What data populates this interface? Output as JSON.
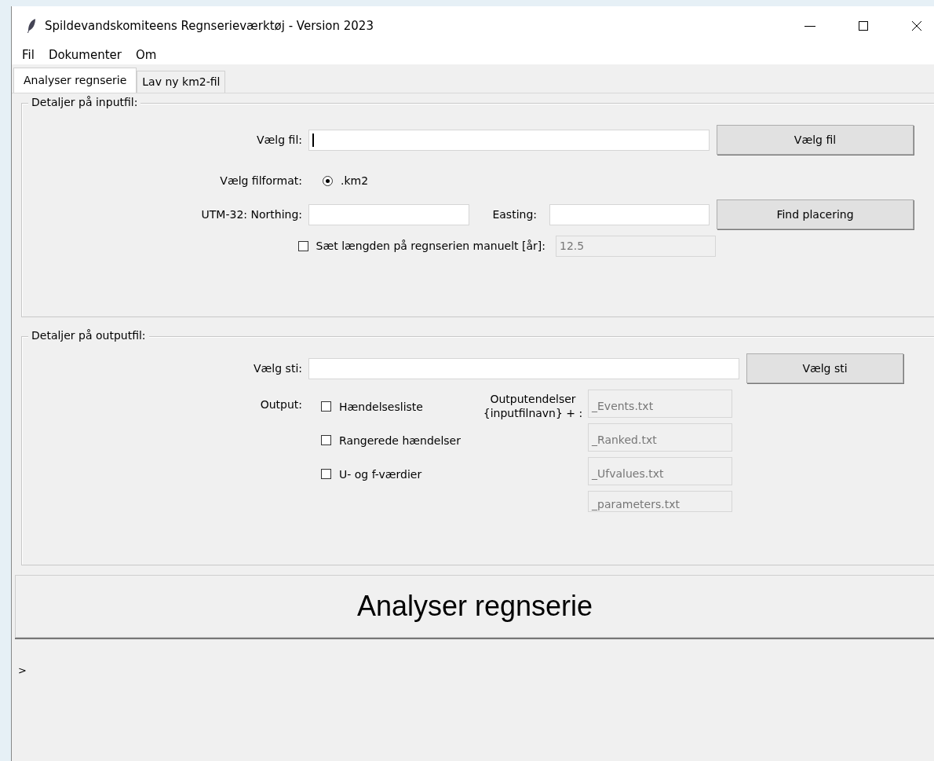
{
  "window": {
    "title": "Spildevandskomiteens Regnserieværktøj - Version 2023"
  },
  "menu": [
    "Fil",
    "Dokumenter",
    "Om"
  ],
  "tabs": [
    {
      "label": "Analyser regnserie",
      "selected": true
    },
    {
      "label": "Lav ny km2-fil",
      "selected": false
    }
  ],
  "input_frame": {
    "legend": "Detaljer på inputfil:",
    "file": {
      "label": "Vælg fil:",
      "focused": true,
      "button": "Vælg fil"
    },
    "format": {
      "label": "Vælg filformat:",
      "options": [
        {
          "label": ".km2",
          "selected": true
        }
      ]
    },
    "utm": {
      "label": "UTM-32: Northing:",
      "easting_label": "Easting:",
      "button": "Find placering"
    },
    "manual_length": {
      "label": "Sæt længden på regnserien manuelt [år]:",
      "checked": false,
      "value": "12.5",
      "disabled": true
    }
  },
  "output_frame": {
    "legend": "Detaljer på outputfil:",
    "path": {
      "label": "Vælg sti:",
      "button": "Vælg sti"
    },
    "output_label": "Output:",
    "outputs": [
      {
        "label": "Hændelsesliste",
        "checked": false
      },
      {
        "label": "Rangerede hændelser",
        "checked": false
      },
      {
        "label": "U- og f-værdier",
        "checked": false
      }
    ],
    "suffix_label": "Outputendelser\n{inputfilnavn} + :",
    "suffixes": [
      {
        "value": "_Events.txt",
        "disabled": true
      },
      {
        "value": "_Ranked.txt",
        "disabled": true
      },
      {
        "value": "_Ufvalues.txt",
        "disabled": true
      },
      {
        "value": "_parameters.txt",
        "disabled": true
      }
    ]
  },
  "run_button": "Analyser regnserie",
  "console": {
    "prompt": ">"
  }
}
